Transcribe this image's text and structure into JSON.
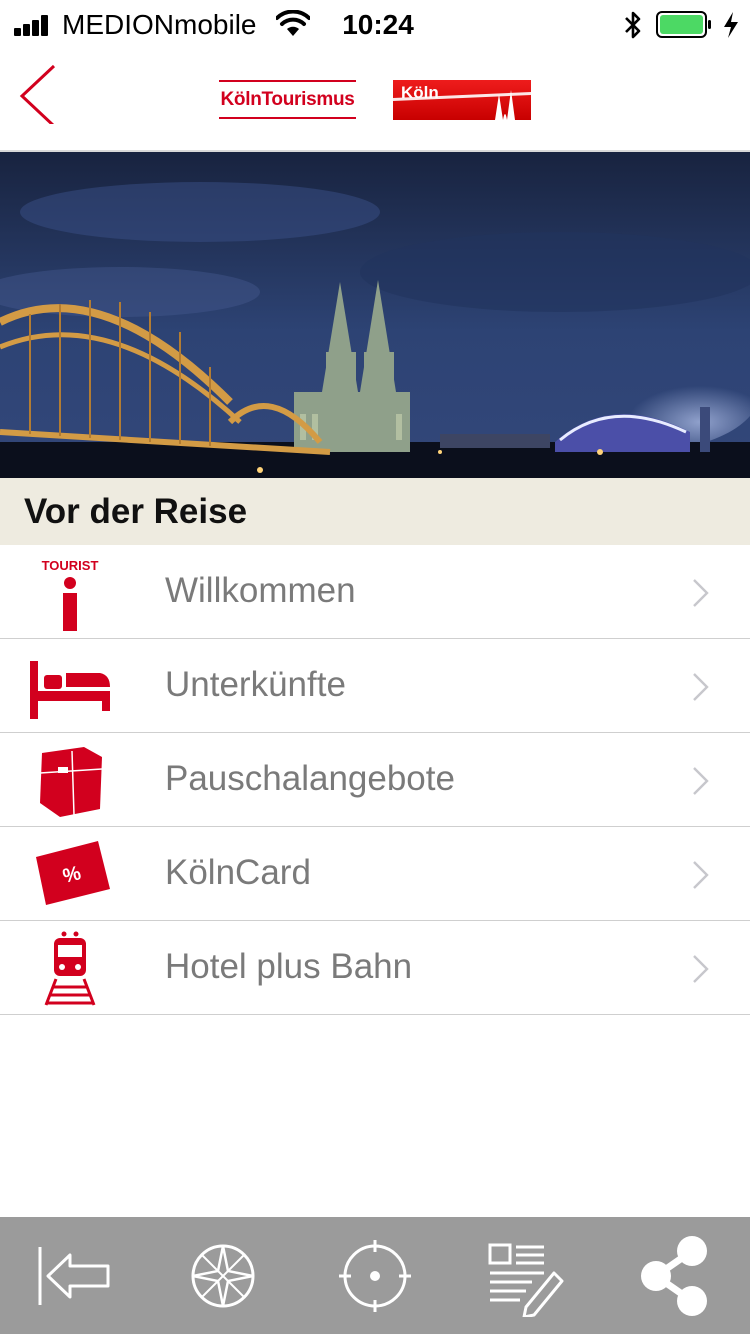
{
  "status_bar": {
    "carrier": "MEDIONmobile",
    "time": "10:24",
    "battery_color": "#4cd964"
  },
  "header": {
    "logo_left": "KölnTourismus",
    "logo_right": "Köln",
    "accent_color": "#d2001e"
  },
  "hero": {
    "image": "cologne-cathedral-night-panorama"
  },
  "section": {
    "title": "Vor der Reise"
  },
  "menu": {
    "items": [
      {
        "label": "Willkommen",
        "icon": "tourist-info-icon",
        "icon_text": "TOURIST"
      },
      {
        "label": "Unterkünfte",
        "icon": "bed-icon"
      },
      {
        "label": "Pauschalangebote",
        "icon": "package-icon"
      },
      {
        "label": "KölnCard",
        "icon": "discount-card-icon",
        "icon_text": "%"
      },
      {
        "label": "Hotel plus Bahn",
        "icon": "train-icon"
      }
    ]
  },
  "toolbar": {
    "buttons": [
      "back-to-start-icon",
      "compass-icon",
      "locate-icon",
      "notes-edit-icon",
      "share-icon"
    ]
  }
}
